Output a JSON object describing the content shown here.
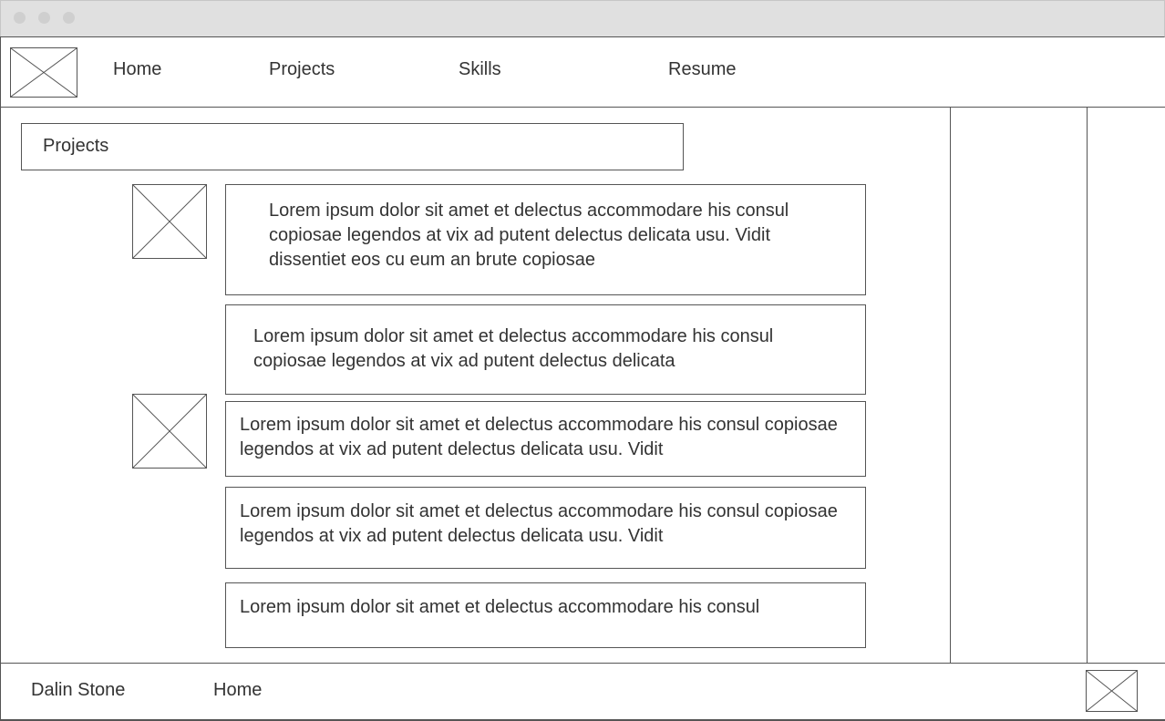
{
  "nav": {
    "items": [
      {
        "label": "Home"
      },
      {
        "label": "Projects"
      },
      {
        "label": "Skills"
      },
      {
        "label": "Resume"
      }
    ]
  },
  "main": {
    "section_title": "Projects",
    "cards": [
      {
        "text": "Lorem ipsum dolor sit amet et delectus accommodare his consul copiosae legendos at vix ad putent delectus delicata usu. Vidit dissentiet eos cu eum an brute copiosae"
      },
      {
        "text": "Lorem ipsum dolor sit amet et delectus accommodare his consul copiosae legendos at vix ad putent delectus delicata"
      },
      {
        "text": "Lorem ipsum dolor sit amet et delectus accommodare his consul copiosae legendos at vix ad putent delectus delicata usu. Vidit"
      },
      {
        "text": "Lorem ipsum dolor sit amet et delectus accommodare his consul copiosae legendos at vix ad putent delectus delicata usu. Vidit"
      },
      {
        "text": "Lorem ipsum dolor sit amet et delectus accommodare his consul"
      }
    ]
  },
  "footer": {
    "name": "Dalin Stone",
    "link": "Home"
  },
  "colors": {
    "line": "#555555",
    "titlebar": "#e0e0e0",
    "text": "#333333"
  }
}
